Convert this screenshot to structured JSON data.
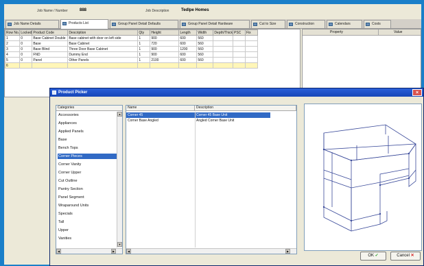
{
  "header": {
    "job_label": "Job Name / Number",
    "job_value": "888",
    "desc_label": "Job Description",
    "desc_value": "Tedlpe Homes"
  },
  "tabs": [
    {
      "label": "Job Name Details",
      "active": false
    },
    {
      "label": "Products List",
      "active": true
    },
    {
      "label": "Group Panel Detail Defaults",
      "active": false
    },
    {
      "label": "Group Panel Detail Hardware",
      "active": false
    },
    {
      "label": "Cut to Size",
      "active": false
    },
    {
      "label": "Construction",
      "active": false
    },
    {
      "label": "Calendars",
      "active": false
    },
    {
      "label": "Costs",
      "active": false
    }
  ],
  "grid": {
    "columns": [
      "Row No.",
      "Locked",
      "Product Code",
      "Description",
      "Qty",
      "Height",
      "Length",
      "Width",
      "Depth/Thick",
      "PSC",
      "Fix"
    ],
    "rows": [
      [
        "1",
        "0",
        "Base Cabinet Double",
        "Base cabinet with door on left side",
        "1",
        "900",
        "600",
        "560",
        "",
        "",
        ""
      ],
      [
        "2",
        "0",
        "Base",
        "Base Cabinet",
        "1",
        "720",
        "600",
        "560",
        "",
        "",
        ""
      ],
      [
        "3",
        "0",
        "Base Blind",
        "Three Door Base Cabinet",
        "1",
        "900",
        "1200",
        "560",
        "",
        "",
        ""
      ],
      [
        "4",
        "0",
        "FND",
        "Dummy End",
        "1",
        "900",
        "600",
        "560",
        "",
        "",
        ""
      ],
      [
        "5",
        "0",
        "Panel",
        "Other Panels",
        "1",
        "2100",
        "600",
        "560",
        "",
        "",
        ""
      ],
      [
        "6",
        "",
        "",
        "",
        "",
        "",
        "",
        "",
        "",
        "",
        ""
      ]
    ]
  },
  "properties": {
    "col1": "Property",
    "col2": "Value"
  },
  "dialog": {
    "title": "Product Picker",
    "categories_header": "Categories",
    "categories": [
      "Accessories",
      "Appliances",
      "Applied Panels",
      "Base",
      "Bench Tops",
      "Corner Pieces",
      "Corner Vanity",
      "Corner Upper",
      "Cut Outline",
      "Pantry Section",
      "Panel Segment",
      "Wraparound Units",
      "Specials",
      "Tall",
      "Upper",
      "Vanities"
    ],
    "selected_category_index": 5,
    "products_header_name": "Name",
    "products_header_desc": "Description",
    "products": [
      {
        "name": "Corner 45",
        "desc": "Corner 45 Base Unit",
        "selected": true
      },
      {
        "name": "Corner Base Angled",
        "desc": "Angled Corner Base Unit",
        "selected": false
      }
    ],
    "ok_label": "OK",
    "cancel_label": "Cancel"
  },
  "colors": {
    "background": "#1a7fc9",
    "titlebar": "#1747b8",
    "selection": "#316ac5"
  }
}
